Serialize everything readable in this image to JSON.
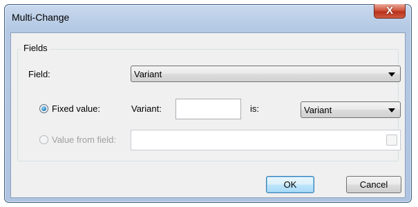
{
  "window": {
    "title": "Multi-Change",
    "close_glyph": "X"
  },
  "fields_group": {
    "legend": "Fields",
    "field_label": "Field:",
    "field_value": "Variant",
    "fixed_value_label": "Fixed value:",
    "fixed_value_checked": true,
    "variant_label": "Variant:",
    "variant_input_value": "",
    "is_label": "is:",
    "is_value": "Variant",
    "value_from_field_label": "Value from field:",
    "value_from_field_checked": false,
    "value_from_field_enabled": false,
    "value_from_field_input": ""
  },
  "buttons": {
    "ok_label": "OK",
    "cancel_label": "Cancel"
  },
  "icons": {
    "close": "close-icon",
    "dropdown": "chevron-down-icon"
  }
}
